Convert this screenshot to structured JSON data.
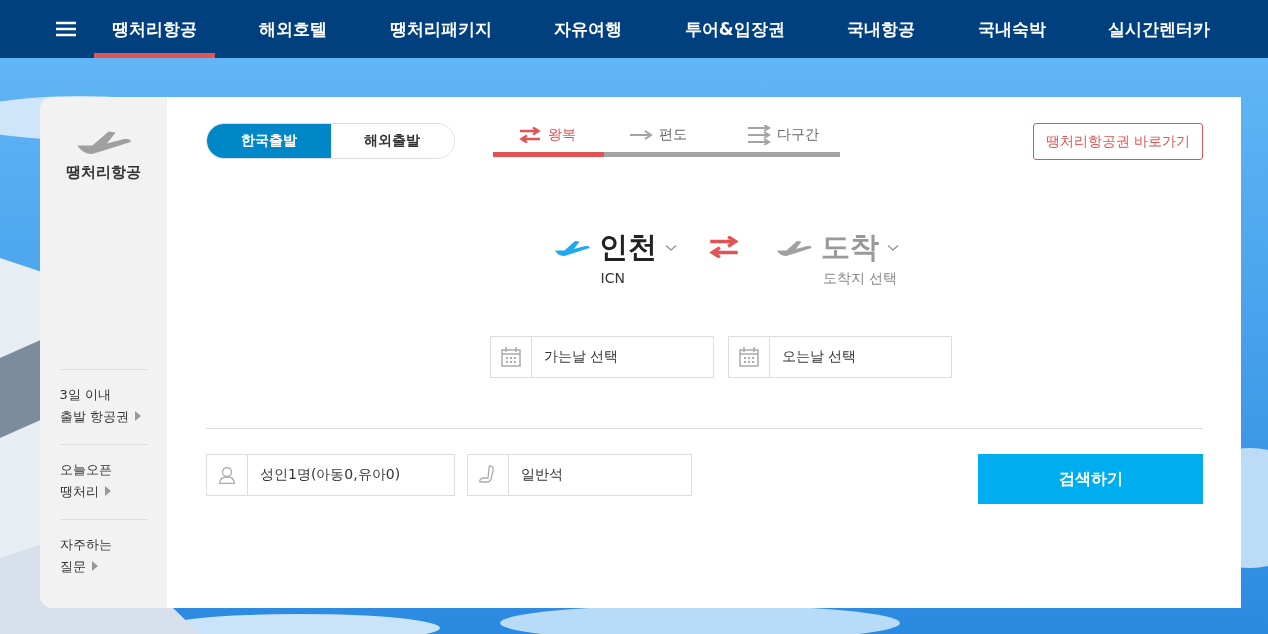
{
  "nav": {
    "items": [
      {
        "label": "땡처리항공",
        "selected": true
      },
      {
        "label": "해외호텔",
        "selected": false
      },
      {
        "label": "땡처리패키지",
        "selected": false
      },
      {
        "label": "자유여행",
        "selected": false
      },
      {
        "label": "투어&입장권",
        "selected": false
      },
      {
        "label": "국내항공",
        "selected": false
      },
      {
        "label": "국내숙박",
        "selected": false
      },
      {
        "label": "실시간렌터카",
        "selected": false
      }
    ]
  },
  "sidebar": {
    "title": "땡처리항공",
    "links": [
      {
        "lines": [
          "3일 이내",
          "출발 항공권"
        ]
      },
      {
        "lines": [
          "오늘오픈",
          "땡처리"
        ]
      },
      {
        "lines": [
          "자주하는",
          "질문"
        ]
      }
    ]
  },
  "origin_tabs": [
    {
      "label": "한국출발",
      "selected": true
    },
    {
      "label": "해외출발",
      "selected": false
    }
  ],
  "trip_types": [
    {
      "kind": "roundtrip",
      "label": "왕복",
      "selected": true
    },
    {
      "kind": "oneway",
      "label": "편도",
      "selected": false
    },
    {
      "kind": "multicity",
      "label": "다구간",
      "selected": false
    }
  ],
  "shortcut_button": "땡처리항공권 바로가기",
  "route": {
    "departure": {
      "city": "인천",
      "code": "ICN",
      "set": true
    },
    "arrival": {
      "city": "도착",
      "code": "도착지 선택",
      "set": false
    }
  },
  "dates": [
    {
      "text": "가는날 선택"
    },
    {
      "text": "오는날 선택"
    }
  ],
  "passengers": {
    "text": "성인1명(아동0,유아0)"
  },
  "cabin": {
    "text": "일반석"
  },
  "search_button": "검색하기"
}
